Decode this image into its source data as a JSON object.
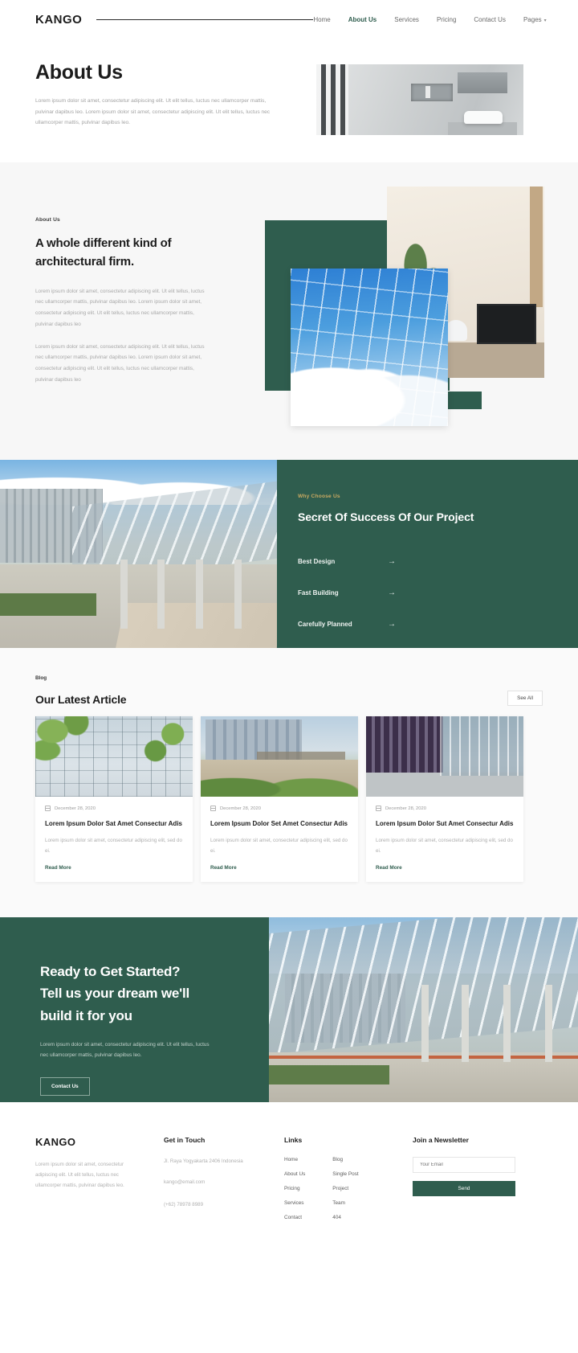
{
  "header": {
    "logo": "KANGO",
    "nav": [
      {
        "label": "Home",
        "active": false
      },
      {
        "label": "About Us",
        "active": true
      },
      {
        "label": "Services",
        "active": false
      },
      {
        "label": "Pricing",
        "active": false
      },
      {
        "label": "Contact Us",
        "active": false
      },
      {
        "label": "Pages",
        "active": false,
        "caret": "▾"
      }
    ]
  },
  "hero": {
    "title": "About Us",
    "description": "Lorem ipsum dolor sit amet, consectetur adipiscing elit. Ut elit tellus, luctus nec ullamcorper mattis, pulvinar dapibus leo. Lorem ipsum dolor sit amet, consectetur adipiscing elit. Ut elit tellus, luctus nec ullamcorper mattis, pulvinar dapibus leo."
  },
  "about": {
    "eyebrow": "About Us",
    "title": "A whole different kind of architectural firm.",
    "paragraph1": "Lorem ipsum dolor sit amet, consectetur adipiscing elit. Ut elit tellus, luctus nec ullamcorper mattis, pulvinar dapibus leo. Lorem ipsum dolor sit amet, consectetur adipiscing elit. Ut elit tellus, luctus nec ullamcorper mattis, pulvinar dapibus leo",
    "paragraph2": "Lorem ipsum dolor sit amet, consectetur adipiscing elit. Ut elit tellus, luctus nec ullamcorper mattis, pulvinar dapibus leo. Lorem ipsum dolor sit amet, consectetur adipiscing elit. Ut elit tellus, luctus nec ullamcorper mattis, pulvinar dapibus leo"
  },
  "why": {
    "eyebrow": "Why Choose Us",
    "title": "Secret Of Success Of Our Project",
    "accent_color": "#c9a961",
    "background_color": "#2f5d4e",
    "items": [
      {
        "label": "Best Design",
        "arrow": "→"
      },
      {
        "label": "Fast Building",
        "arrow": "→"
      },
      {
        "label": "Carefully Planned",
        "arrow": "→"
      }
    ]
  },
  "blog": {
    "eyebrow": "Blog",
    "title": "Our Latest Article",
    "see_all_label": "See All",
    "cards": [
      {
        "date": "December 28, 2020",
        "title": "Lorem Ipsum Dolor Sat Amet Consectur Adis",
        "desc": "Lorem ipsum dolor sit amet, consectetur adipiscing elit, sed do ei.",
        "read_more": "Read More"
      },
      {
        "date": "December 28, 2020",
        "title": "Lorem Ipsum Dolor Set Amet Consectur Adis",
        "desc": "Lorem ipsum dolor sit amet, consectetur adipiscing elit, sed do ei.",
        "read_more": "Read More"
      },
      {
        "date": "December 28, 2020",
        "title": "Lorem Ipsum Dolor Sut Amet Consectur Adis",
        "desc": "Lorem ipsum dolor sit amet, consectetur adipiscing elit, sed do ei.",
        "read_more": "Read More"
      }
    ]
  },
  "cta": {
    "title": "Ready to Get Started? Tell us your dream we'll build it for you",
    "description": "Lorem ipsum dolor sit amet, consectetur adipiscing elit. Ut elit tellus, luctus nec ullamcorper mattis, pulvinar dapibus leo.",
    "button_label": "Contact Us"
  },
  "footer": {
    "logo": "KANGO",
    "about": "Lorem ipsum dolor sit amet, consectetur adipiscing elit. Ut elit tellus, luctus nec ullamcorper mattis, pulvinar dapibus leo.",
    "touch_heading": "Get in Touch",
    "address": "Jl. Raya Yogyakarta 2406 Indonesia",
    "email": "kango@email.com",
    "phone": "(+62) 78978 8989",
    "links_heading": "Links",
    "links_col1": [
      "Home",
      "About Us",
      "Pricing",
      "Services",
      "Contact"
    ],
    "links_col2": [
      "Blog",
      "Single Post",
      "Project",
      "Team",
      "404"
    ],
    "newsletter_heading": "Join a Newsletter",
    "email_placeholder": "Your Email",
    "send_label": "Send"
  }
}
